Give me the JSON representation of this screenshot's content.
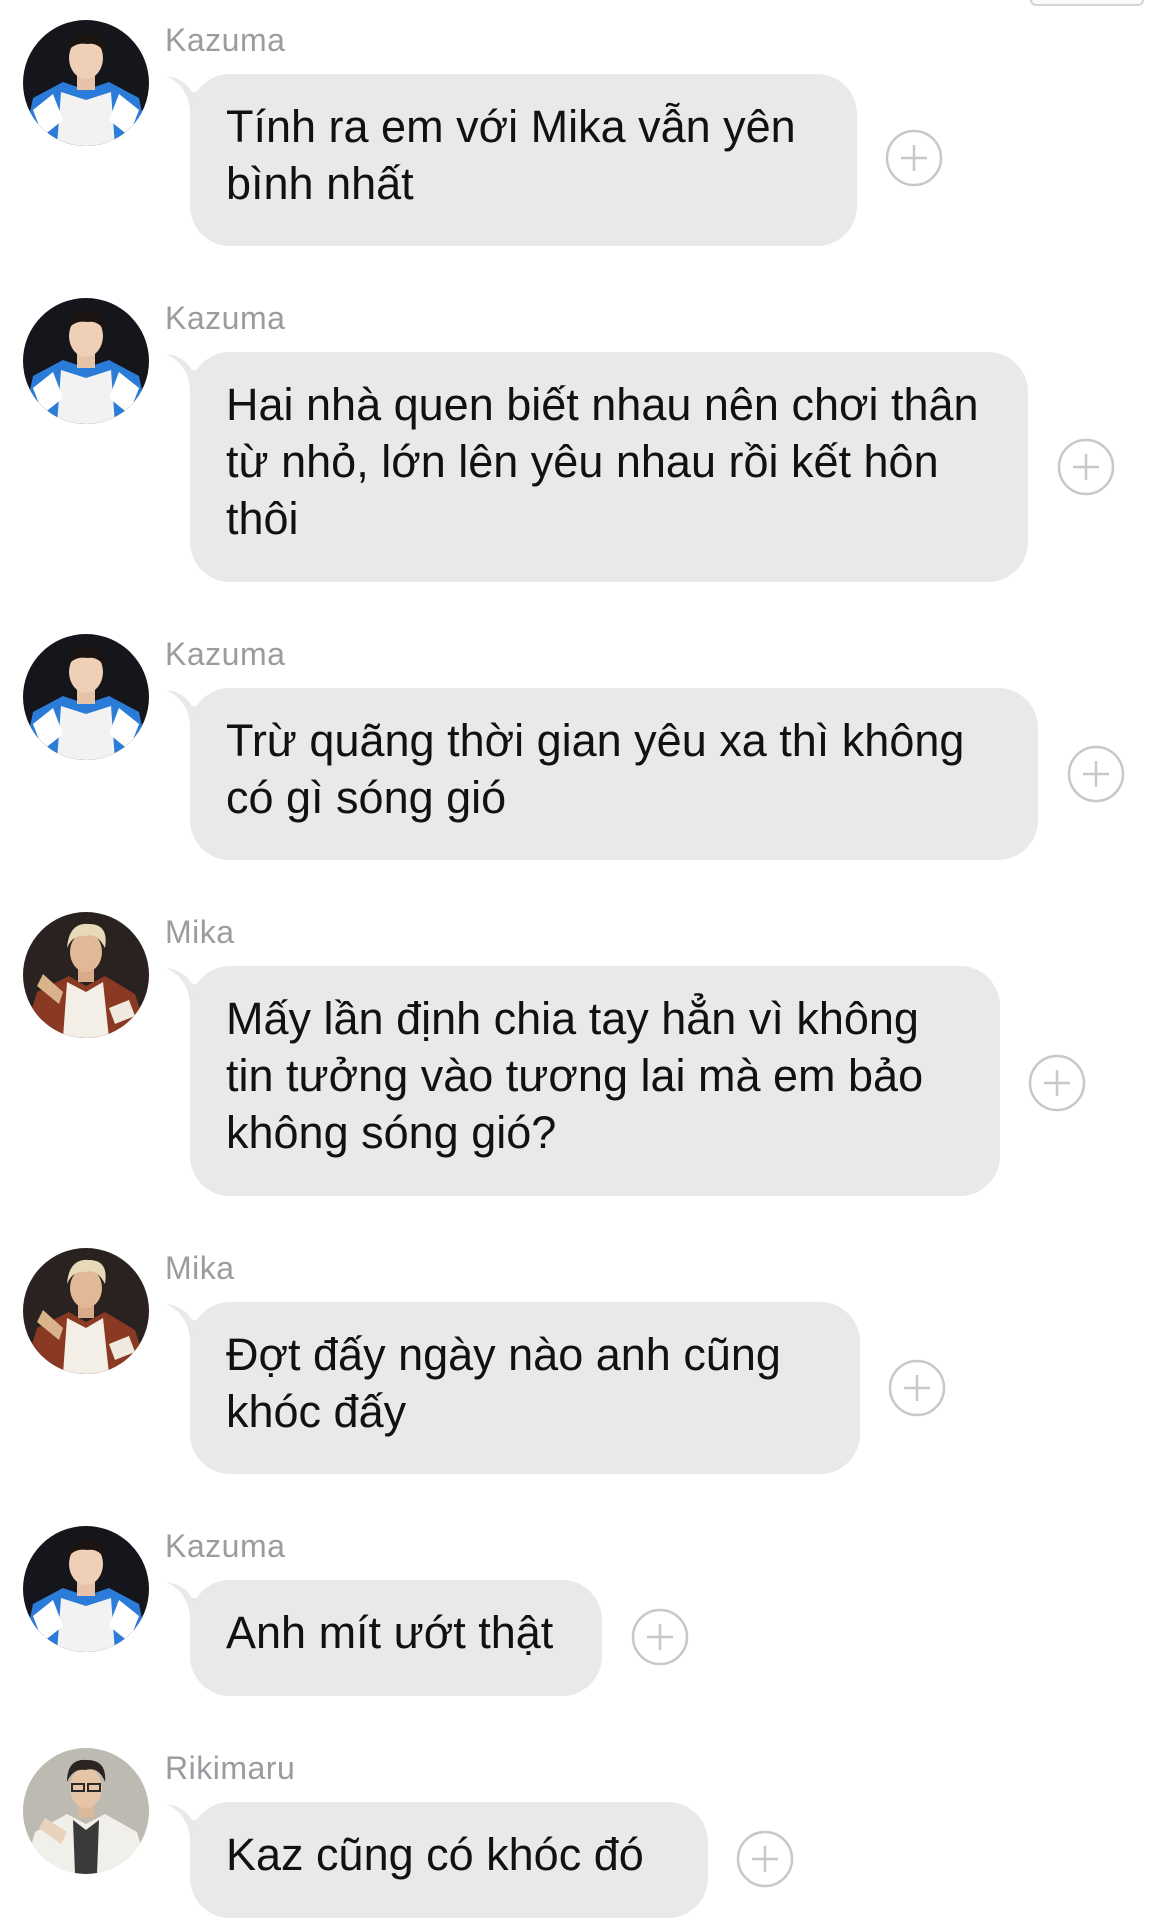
{
  "messages": [
    {
      "sender": "Kazuma",
      "text": "Tính ra em với Mika vẫn yên bình nhất",
      "avatar_icon": "avatar-kazuma-icon"
    },
    {
      "sender": "Kazuma",
      "text": "Hai nhà quen biết nhau nên chơi thân từ nhỏ, lớn lên yêu nhau rồi kết hôn thôi",
      "avatar_icon": "avatar-kazuma-icon"
    },
    {
      "sender": "Kazuma",
      "text": "Trừ quãng thời gian yêu xa thì không có gì sóng gió",
      "avatar_icon": "avatar-kazuma-icon"
    },
    {
      "sender": "Mika",
      "text": "Mấy lần định chia tay hẳn vì không tin tưởng vào tương lai mà em bảo không sóng gió?",
      "avatar_icon": "avatar-mika-icon"
    },
    {
      "sender": "Mika",
      "text": "Đợt đấy ngày nào anh cũng khóc đấy",
      "avatar_icon": "avatar-mika-icon"
    },
    {
      "sender": "Kazuma",
      "text": "Anh mít ướt thật",
      "avatar_icon": "avatar-kazuma-icon"
    },
    {
      "sender": "Rikimaru",
      "text": "Kaz cũng có khóc đó",
      "avatar_icon": "avatar-rikimaru-icon"
    }
  ],
  "colors": {
    "bubble": "#e9e9eb",
    "text": "#111111",
    "sender": "#9b9ba0",
    "react_icon": "#c7c7cc"
  },
  "icons": {
    "reaction": "add-reaction-icon"
  }
}
